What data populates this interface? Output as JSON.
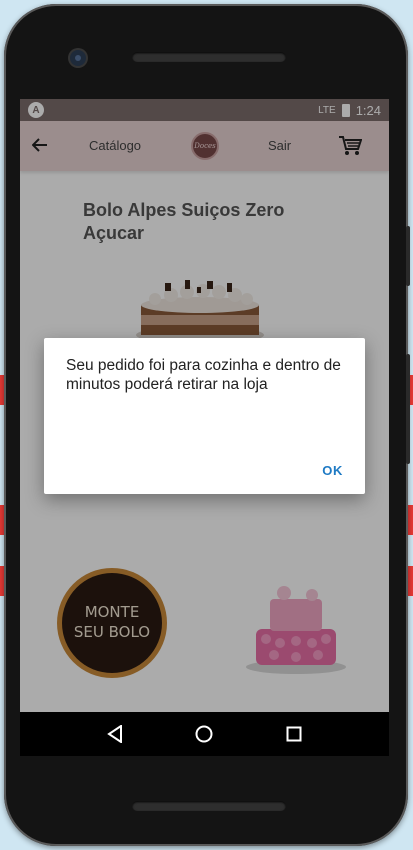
{
  "status_bar": {
    "app_icon": "A",
    "signal_label": "LTE",
    "time": "1:24"
  },
  "app_bar": {
    "back_icon": "arrow-left-icon",
    "catalog_label": "Catálogo",
    "logo_text": "Doces",
    "logout_label": "Sair",
    "cart_icon": "cart-icon"
  },
  "product": {
    "title": "Bolo Alpes Suiços Zero Açucar"
  },
  "promo": {
    "monte_line1": "MONTE",
    "monte_line2": "SEU BOLO"
  },
  "dialog": {
    "message": "Seu pedido foi para cozinha e dentro de minutos poderá retirar na loja",
    "ok_label": "OK"
  },
  "nav": {
    "back_icon": "nav-back-icon",
    "home_icon": "nav-home-icon",
    "recents_icon": "nav-recents-icon"
  },
  "colors": {
    "appbar": "#e8d3d3",
    "statusbar": "#7d6d6c",
    "accent": "#1e7ac4"
  }
}
